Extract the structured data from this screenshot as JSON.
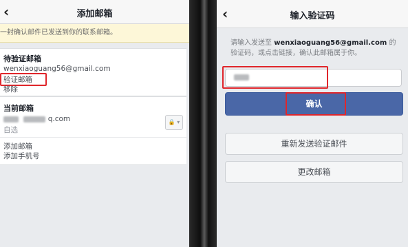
{
  "left": {
    "nav": {
      "back": "‹",
      "title": "添加邮箱"
    },
    "notice": "一封确认邮件已发送到你的联系邮箱。",
    "pending": {
      "title": "待验证邮箱",
      "email": "wenxiaoguang56@gmail.com",
      "verify_link": "验证邮箱",
      "remove_link": "移除"
    },
    "current": {
      "title": "当前邮箱",
      "email_suffix": "q.com",
      "privacy": "自选",
      "lock_label": "🔒 ▾"
    },
    "add_email": "添加邮箱",
    "add_phone": "添加手机号"
  },
  "right": {
    "nav": {
      "back": "‹",
      "title": "输入验证码"
    },
    "instr_prefix": "请输入发送至",
    "instr_email": "wenxiaoguang56@gmail.com",
    "instr_suffix": "的验证码，或点击链接，确认此邮箱属于你。",
    "confirm": "确认",
    "resend": "重新发送验证邮件",
    "change": "更改邮箱"
  },
  "colors": {
    "highlight": "#e0262b",
    "primary_button": "#4a67a7"
  }
}
